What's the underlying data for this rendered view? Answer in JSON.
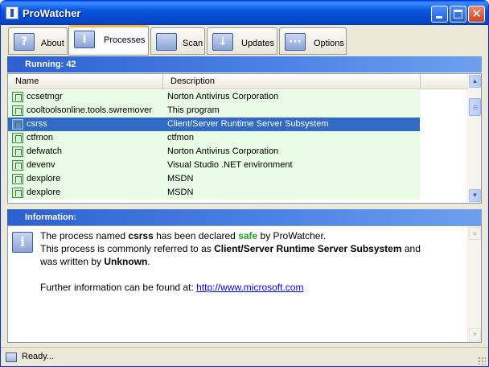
{
  "window": {
    "title": "ProWatcher"
  },
  "title_buttons": {
    "close_glyph": "✕"
  },
  "tabs": [
    {
      "label": "About",
      "icon": "question-icon",
      "glyph": "?"
    },
    {
      "label": "Processes",
      "icon": "info-icon",
      "glyph": "i",
      "active": true
    },
    {
      "label": "Scan",
      "icon": "scan-icon",
      "glyph": ""
    },
    {
      "label": "Updates",
      "icon": "download-arrow-icon",
      "glyph": "↓"
    },
    {
      "label": "Options",
      "icon": "options-icon",
      "glyph": "···"
    }
  ],
  "running": {
    "header": "Running: 42",
    "columns": {
      "name": "Name",
      "description": "Description"
    },
    "rows": [
      {
        "name": "ccsetmgr",
        "description": "Norton Antivirus Corporation"
      },
      {
        "name": "cooltoolsonline.tools.swremover",
        "description": "This program"
      },
      {
        "name": "csrss",
        "description": "Client/Server Runtime Server Subsystem",
        "selected": true
      },
      {
        "name": "ctfmon",
        "description": "ctfmon"
      },
      {
        "name": "defwatch",
        "description": "Norton Antivirus Corporation"
      },
      {
        "name": "devenv",
        "description": "Visual Studio .NET environment"
      },
      {
        "name": "dexplore",
        "description": "MSDN"
      },
      {
        "name": "dexplore",
        "description": "MSDN"
      }
    ],
    "scroll_up": "▲",
    "scroll_down": "▼"
  },
  "information": {
    "header": "Information:",
    "line1_pre": "The process named ",
    "process_name": "csrss",
    "line1_mid": " has been declared ",
    "status_word": "safe",
    "line1_post": " by ProWatcher.",
    "line2_pre": "This process is commonly referred to as ",
    "common_name": "Client/Server Runtime Server Subsystem",
    "line2_post": " and",
    "line3_pre": "was written by ",
    "author": "Unknown",
    "line3_post": ".",
    "further_pre": "Further information can be found at: ",
    "link": "http://www.microsoft.com",
    "scroll_up": "▲",
    "scroll_down": "▼"
  },
  "status": {
    "text": "Ready..."
  },
  "colors": {
    "accent": "#316ac5",
    "row_bg": "#e8fbe4",
    "safe": "#1fa51f"
  }
}
